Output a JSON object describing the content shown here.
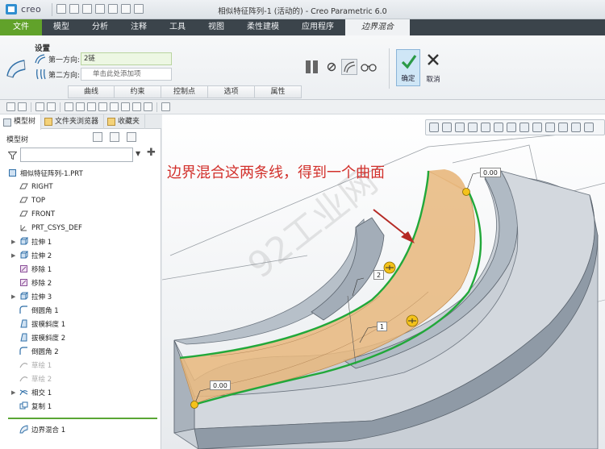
{
  "app": {
    "brand": "creo",
    "window_title": "相似特征阵列-1 (活动的) - Creo Parametric 6.0"
  },
  "ribbon_tabs": [
    {
      "label": "文件"
    },
    {
      "label": "模型"
    },
    {
      "label": "分析"
    },
    {
      "label": "注释"
    },
    {
      "label": "工具"
    },
    {
      "label": "视图"
    },
    {
      "label": "柔性建模"
    },
    {
      "label": "应用程序"
    },
    {
      "label": "边界混合"
    }
  ],
  "ribbon": {
    "settings_label": "设置",
    "first_direction": {
      "label": "第一方向:",
      "value": "2链"
    },
    "second_direction": {
      "label": "第二方向:",
      "value": "单击此处添加项"
    },
    "subtabs": [
      "曲线",
      "约束",
      "控制点",
      "选项",
      "属性"
    ],
    "ok_label": "确定",
    "cancel_label": "取消"
  },
  "panel": {
    "tabs": [
      "模型树",
      "文件夹浏览器",
      "收藏夹"
    ],
    "tree_header": "模型树",
    "search_placeholder": ""
  },
  "tree": [
    {
      "label": "相似特征阵列-1.PRT",
      "icon": "part-icon",
      "root": true
    },
    {
      "label": "RIGHT",
      "icon": "datum-plane-icon"
    },
    {
      "label": "TOP",
      "icon": "datum-plane-icon"
    },
    {
      "label": "FRONT",
      "icon": "datum-plane-icon"
    },
    {
      "label": "PRT_CSYS_DEF",
      "icon": "csys-icon"
    },
    {
      "label": "拉伸 1",
      "icon": "extrude-icon",
      "expandable": true
    },
    {
      "label": "拉伸 2",
      "icon": "extrude-icon",
      "expandable": true
    },
    {
      "label": "移除 1",
      "icon": "remove-icon"
    },
    {
      "label": "移除 2",
      "icon": "remove-icon"
    },
    {
      "label": "拉伸 3",
      "icon": "extrude-icon",
      "expandable": true
    },
    {
      "label": "倒圆角 1",
      "icon": "round-icon"
    },
    {
      "label": "拔模斜度 1",
      "icon": "draft-icon"
    },
    {
      "label": "拔模斜度 2",
      "icon": "draft-icon"
    },
    {
      "label": "倒圆角 2",
      "icon": "round-icon"
    },
    {
      "label": "草绘 1",
      "icon": "sketch-icon",
      "dim": true
    },
    {
      "label": "草绘 2",
      "icon": "sketch-icon",
      "dim": true
    },
    {
      "label": "相交 1",
      "icon": "intersect-icon",
      "expandable": true
    },
    {
      "label": "复制 1",
      "icon": "copy-icon"
    }
  ],
  "active_feature": {
    "label": "边界混合 1",
    "icon": "boundary-blend-icon"
  },
  "viewport": {
    "annotation": "边界混合这两条线，得到一个曲面",
    "watermark": "92工业网",
    "labels": {
      "value_top": "0.00",
      "value_bottom": "0.00",
      "chain_1": "1",
      "chain_2": "2"
    },
    "colors": {
      "surface": "#e8b77c",
      "chain": "#21a83a",
      "handle": "#f4c21a",
      "annotation": "#d2302b",
      "accent": "#61a22a"
    }
  }
}
